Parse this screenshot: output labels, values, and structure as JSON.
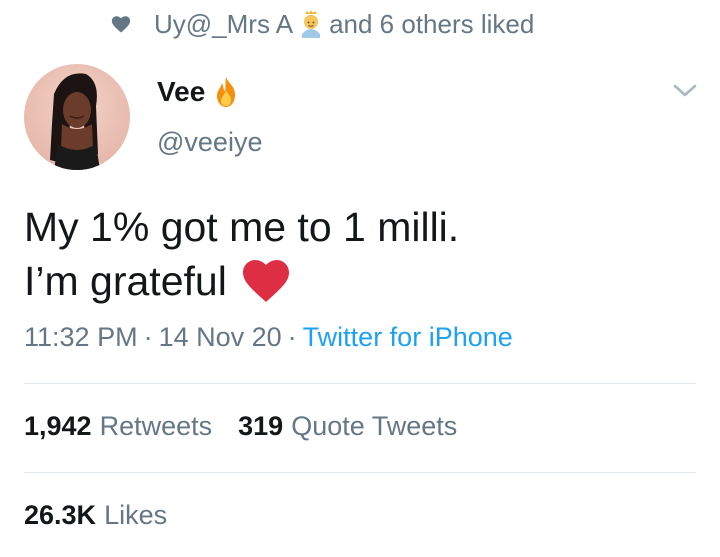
{
  "social_context": {
    "user": "Uy@_Mrs A",
    "suffix": "and 6 others liked"
  },
  "author": {
    "name": "Vee",
    "handle": "@veeiye"
  },
  "tweet": {
    "line1": "My 1% got me to 1 milli.",
    "line2": "I’m grateful"
  },
  "meta": {
    "time": "11:32 PM",
    "date": "14 Nov 20",
    "source": "Twitter for iPhone",
    "separator": "·"
  },
  "stats": {
    "retweets_count": "1,942",
    "retweets_label": "Retweets",
    "quotes_count": "319",
    "quotes_label": "Quote Tweets",
    "likes_count": "26.3K",
    "likes_label": "Likes"
  },
  "icons": {
    "social_heart": "heart-icon",
    "social_emoji": "person-emoji-icon",
    "name_emoji": "fire-icon",
    "menu": "chevron-down-icon",
    "tweet_emoji": "red-heart-icon"
  },
  "colors": {
    "secondary_text": "#657786",
    "link": "#1da1f2",
    "heart_red": "#dd2e44"
  }
}
